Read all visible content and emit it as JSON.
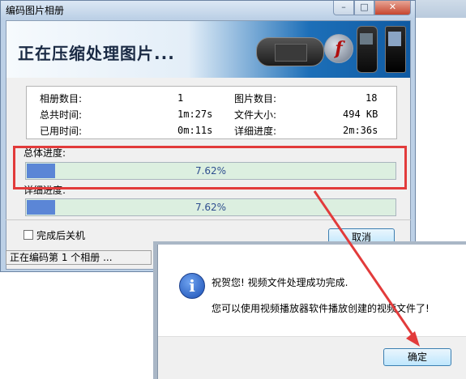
{
  "window": {
    "title": "编码图片相册",
    "minimize_glyph": "–",
    "maximize_glyph": "□",
    "close_glyph": "✕"
  },
  "banner": {
    "title": "正在压缩处理图片...",
    "flash_glyph": "f"
  },
  "info": {
    "album_count_label": "相册数目:",
    "album_count_value": "1",
    "image_count_label": "图片数目:",
    "image_count_value": "18",
    "total_time_label": "总共时间:",
    "total_time_value": "1m:27s",
    "file_size_label": "文件大小:",
    "file_size_value": "494 KB",
    "elapsed_time_label": "已用时间:",
    "elapsed_time_value": "0m:11s",
    "detail_progress_label": "详细进度:",
    "detail_progress_value": "2m:36s"
  },
  "progress": {
    "overall_label": "总体进度:",
    "overall_text": "7.62%",
    "overall_fraction": 0.0762,
    "detail_label": "详细进度:",
    "detail_text": "7.62%",
    "detail_fraction": 0.0762,
    "fill_color": "#5b86d6",
    "track_color": "#dcefe0"
  },
  "options": {
    "shutdown_label": "完成后关机",
    "shutdown_checked": false
  },
  "buttons": {
    "cancel_label": "取消"
  },
  "status": {
    "text": "正在编码第 1 个相册 ..."
  },
  "dialog": {
    "icon_glyph": "i",
    "message1": "祝贺您! 视频文件处理成功完成.",
    "message2": "您可以使用视频播放器软件播放创建的视频文件了!",
    "ok_label": "确定"
  },
  "annotation": {
    "highlight_color": "#e23b3b"
  }
}
